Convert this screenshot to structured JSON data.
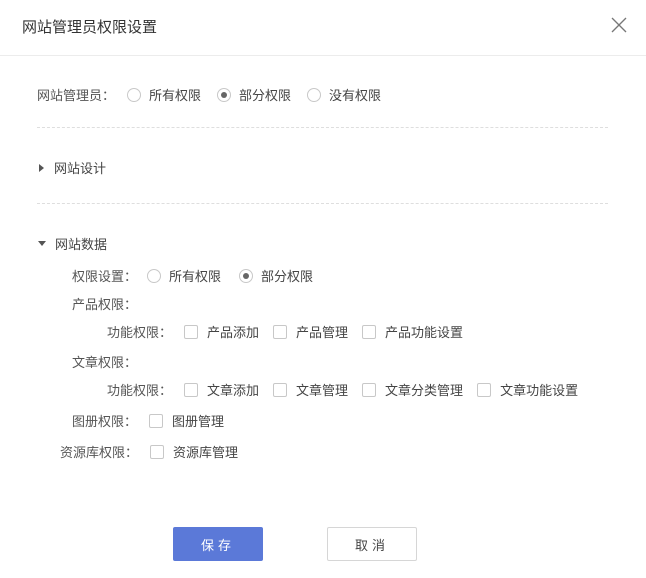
{
  "dialog": {
    "title": "网站管理员权限设置"
  },
  "admin": {
    "label": "网站管理员：",
    "options": [
      {
        "label": "所有权限",
        "checked": false
      },
      {
        "label": "部分权限",
        "checked": true
      },
      {
        "label": "没有权限",
        "checked": false
      }
    ]
  },
  "sections": {
    "design": {
      "title": "网站设计",
      "expanded": false
    },
    "data": {
      "title": "网站数据",
      "expanded": true
    }
  },
  "data_perms": {
    "scope_label": "权限设置：",
    "scope_options": [
      {
        "label": "所有权限",
        "checked": false
      },
      {
        "label": "部分权限",
        "checked": true
      }
    ],
    "product_label": "产品权限：",
    "product_func_label": "功能权限：",
    "product_items": [
      {
        "label": "产品添加",
        "checked": false
      },
      {
        "label": "产品管理",
        "checked": false
      },
      {
        "label": "产品功能设置",
        "checked": false
      }
    ],
    "article_label": "文章权限：",
    "article_func_label": "功能权限：",
    "article_items": [
      {
        "label": "文章添加",
        "checked": false
      },
      {
        "label": "文章管理",
        "checked": false
      },
      {
        "label": "文章分类管理",
        "checked": false
      },
      {
        "label": "文章功能设置",
        "checked": false
      }
    ],
    "album_label": "图册权限：",
    "album_items": [
      {
        "label": "图册管理",
        "checked": false
      }
    ],
    "library_label": "资源库权限：",
    "library_items": [
      {
        "label": "资源库管理",
        "checked": false
      }
    ]
  },
  "buttons": {
    "save": "保存",
    "cancel": "取消"
  },
  "colors": {
    "primary": "#5b79d8",
    "border": "#c8c8c8",
    "divider": "#dedede"
  }
}
